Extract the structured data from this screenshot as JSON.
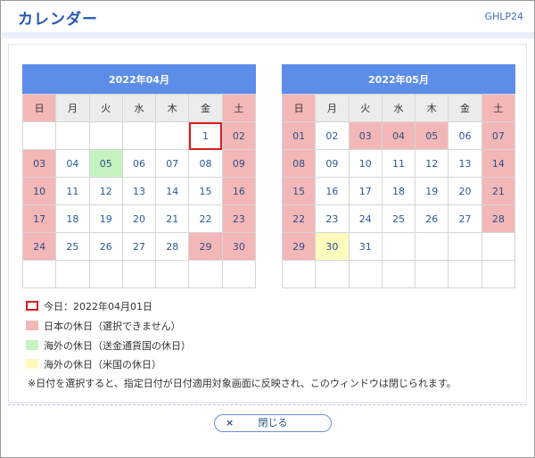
{
  "window": {
    "title": "カレンダー",
    "code": "GHLP24"
  },
  "weekdays": [
    "日",
    "月",
    "火",
    "水",
    "木",
    "金",
    "土"
  ],
  "calendars": [
    {
      "month_label": "2022年04月",
      "weeks": [
        [
          "",
          "",
          "",
          "",
          "",
          "1",
          "02"
        ],
        [
          "03",
          "04",
          "05",
          "06",
          "07",
          "08",
          "09"
        ],
        [
          "10",
          "11",
          "12",
          "13",
          "14",
          "15",
          "16"
        ],
        [
          "17",
          "18",
          "19",
          "20",
          "21",
          "22",
          "23"
        ],
        [
          "24",
          "25",
          "26",
          "27",
          "28",
          "29",
          "30"
        ],
        [
          "",
          "",
          "",
          "",
          "",
          "",
          ""
        ]
      ],
      "holidays_jp": [
        "02",
        "03",
        "09",
        "10",
        "16",
        "17",
        "23",
        "24",
        "29",
        "30"
      ],
      "holidays_overseas": [
        "05"
      ],
      "holidays_us": [],
      "today": "1"
    },
    {
      "month_label": "2022年05月",
      "weeks": [
        [
          "01",
          "02",
          "03",
          "04",
          "05",
          "06",
          "07"
        ],
        [
          "08",
          "09",
          "10",
          "11",
          "12",
          "13",
          "14"
        ],
        [
          "15",
          "16",
          "17",
          "18",
          "19",
          "20",
          "21"
        ],
        [
          "22",
          "23",
          "24",
          "25",
          "26",
          "27",
          "28"
        ],
        [
          "29",
          "30",
          "31",
          "",
          "",
          "",
          ""
        ],
        [
          "",
          "",
          "",
          "",
          "",
          "",
          ""
        ]
      ],
      "holidays_jp": [
        "01",
        "03",
        "04",
        "05",
        "07",
        "08",
        "14",
        "15",
        "21",
        "22",
        "28",
        "29"
      ],
      "holidays_overseas": [],
      "holidays_us": [
        "30"
      ],
      "today": ""
    }
  ],
  "legend": {
    "today": "今日：2022年04月01日",
    "jp": "日本の休日（選択できません）",
    "overseas": "海外の休日（送金通貨国の休日）",
    "us": "海外の休日（米国の休日）"
  },
  "note": "※日付を選択すると、指定日付が日付適用対象画面に反映され、このウィンドウは閉じられます。",
  "close_button": {
    "icon": "×",
    "label": "閉じる"
  },
  "colors": {
    "header_blue": "#5c8de8",
    "holiday_jp": "#f4b7b7",
    "holiday_overseas": "#c6f3c0",
    "holiday_us": "#fdfbbd",
    "today_border": "#d81d1d"
  }
}
